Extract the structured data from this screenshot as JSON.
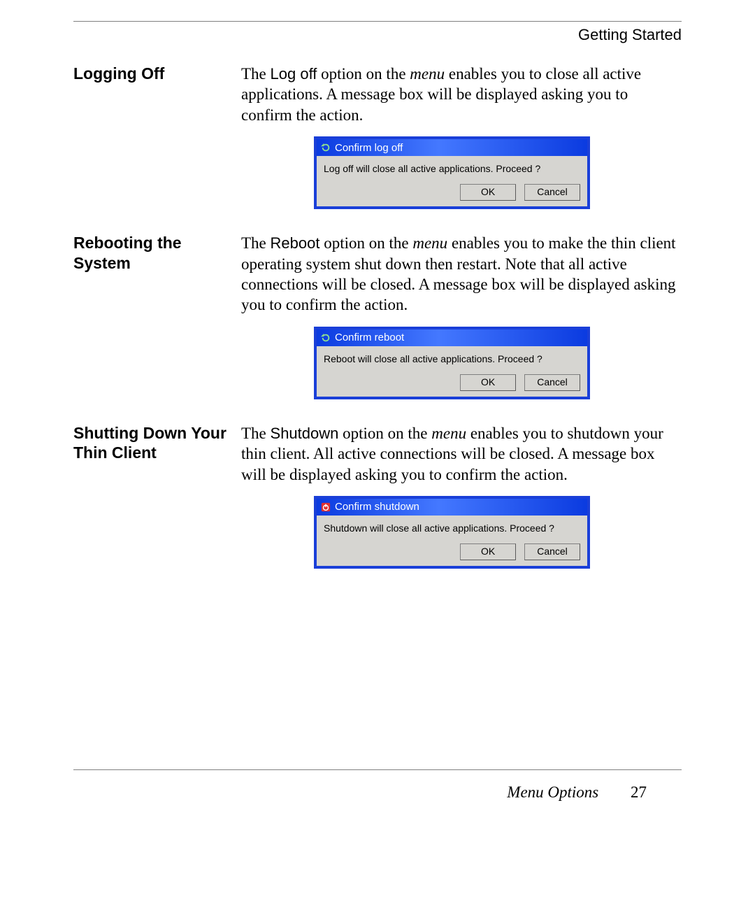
{
  "header": {
    "running_head": "Getting Started"
  },
  "sections": {
    "logoff": {
      "heading": "Logging Off",
      "text_pre": "The ",
      "text_option": "Log off",
      "text_mid1": " option on the ",
      "text_menu": "menu",
      "text_post": " enables you to close all active applications. A message box will be displayed asking you to confirm the action.",
      "dialog": {
        "title": "Confirm log off",
        "message": "Log off will close all active applications. Proceed ?",
        "ok": "OK",
        "cancel": "Cancel"
      }
    },
    "reboot": {
      "heading": "Rebooting the System",
      "text_pre": "The ",
      "text_option": "Reboot",
      "text_mid1": " option on the ",
      "text_menu": "menu",
      "text_post": " enables you to make the thin client operating system shut down then restart. Note that all active connections will be closed. A message box will be displayed asking you to confirm the action.",
      "dialog": {
        "title": "Confirm reboot",
        "message": "Reboot will close all active applications. Proceed ?",
        "ok": "OK",
        "cancel": "Cancel"
      }
    },
    "shutdown": {
      "heading": "Shutting Down Your Thin Client",
      "text_pre": "The ",
      "text_option": "Shutdown",
      "text_mid1": " option on the ",
      "text_menu": "menu",
      "text_post": " enables you to shutdown your thin client. All active connections will be closed. A message box will be displayed asking you to confirm the action.",
      "dialog": {
        "title": "Confirm shutdown",
        "message": "Shutdown  will close all active applications. Proceed ?",
        "ok": "OK",
        "cancel": "Cancel"
      }
    }
  },
  "footer": {
    "section": "Menu Options",
    "page": "27"
  }
}
